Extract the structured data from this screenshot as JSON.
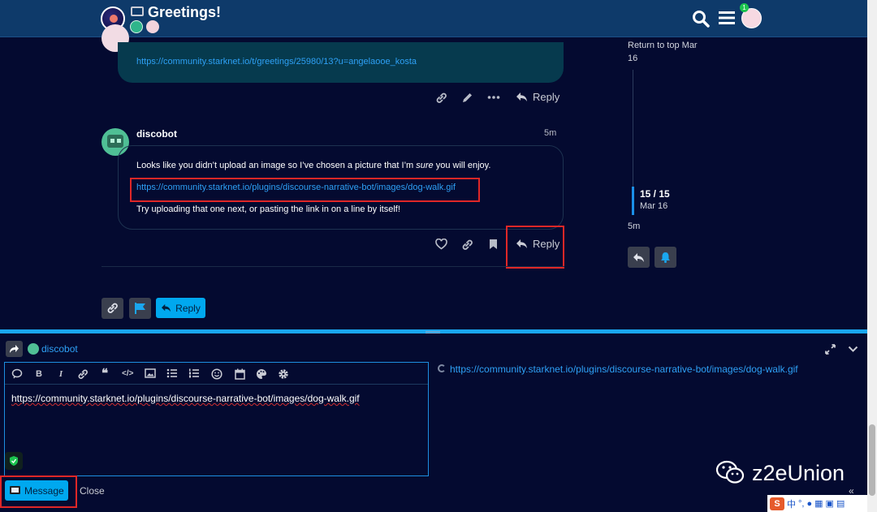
{
  "header": {
    "title": "Greetings!",
    "notification_count": "1"
  },
  "post_prev": {
    "link": "https://community.starknet.io/t/greetings/25980/13?u=angelaooe_kosta",
    "reply_label": "Reply"
  },
  "post_bot": {
    "author": "discobot",
    "time": "5m",
    "line1_before": "Looks like you didn’t upload an image so I’ve chosen a picture that I’m ",
    "line1_em": "sure",
    "line1_after": " you will enjoy.",
    "link": "https://community.starknet.io/plugins/discourse-narrative-bot/images/dog-walk.gif",
    "line3": "Try uploading that one next, or pasting the link in on a line by itself!",
    "reply_label": "Reply"
  },
  "topic_footer": {
    "reply_label": "Reply"
  },
  "timeline": {
    "return_to_top": "Return to top Mar 16",
    "position": "15 / 15",
    "date": "Mar 16",
    "ago": "5m"
  },
  "composer": {
    "recipient": "discobot",
    "editor_text": "https://community.starknet.io/plugins/discourse-narrative-bot/images/dog-walk.gif",
    "preview_link": "https://community.starknet.io/plugins/discourse-narrative-bot/images/dog-walk.gif",
    "submit_label": "Message",
    "close_label": "Close",
    "toolbar": [
      "quote-icon",
      "bold-icon",
      "italic-icon",
      "link-icon",
      "blockquote-icon",
      "code-icon",
      "image-icon",
      "bullet-list-icon",
      "numbered-list-icon",
      "emoji-icon",
      "calendar-icon",
      "palette-icon",
      "gear-icon"
    ]
  },
  "watermark": {
    "text": "z2eUnion"
  },
  "ime": {
    "label": "中"
  },
  "colors": {
    "background": "#040a30",
    "header": "#0e3a6a",
    "accent": "#00a8ef",
    "link": "#2ea0f5",
    "highlight": "#e02727"
  }
}
